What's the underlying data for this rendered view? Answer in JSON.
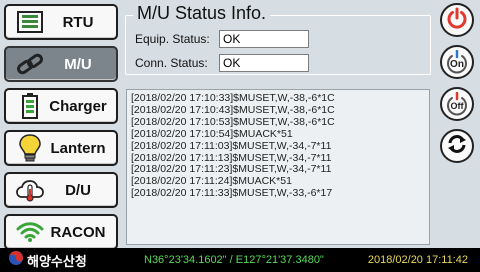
{
  "nav": [
    {
      "id": "rtu",
      "label": "RTU",
      "icon": "rtu-device-icon",
      "active": false
    },
    {
      "id": "mu",
      "label": "M/U",
      "icon": "link-icon",
      "active": true
    },
    {
      "id": "charger",
      "label": "Charger",
      "icon": "battery-icon",
      "active": false
    },
    {
      "id": "lantern",
      "label": "Lantern",
      "icon": "lightbulb-icon",
      "active": false
    },
    {
      "id": "du",
      "label": "D/U",
      "icon": "cloud-thermometer-icon",
      "active": false
    },
    {
      "id": "racon",
      "label": "RACON",
      "icon": "wifi-signal-icon",
      "active": false
    }
  ],
  "panel": {
    "title": "M/U Status Info.",
    "equip_label": "Equip. Status:",
    "equip_value": "OK",
    "conn_label": "Conn. Status:",
    "conn_value": "OK"
  },
  "log": [
    "[2018/02/20 17:10:33]$MUSET,W,-38,-6*1C",
    "[2018/02/20 17:10:43]$MUSET,W,-38,-6*1C",
    "[2018/02/20 17:10:53]$MUSET,W,-38,-6*1C",
    "[2018/02/20 17:10:54]$MUACK*51",
    "[2018/02/20 17:11:03]$MUSET,W,-34,-7*11",
    "[2018/02/20 17:11:13]$MUSET,W,-34,-7*11",
    "[2018/02/20 17:11:23]$MUSET,W,-34,-7*11",
    "[2018/02/20 17:11:24]$MUACK*51",
    "[2018/02/20 17:11:33]$MUSET,W,-33,-6*17"
  ],
  "side_buttons": [
    {
      "id": "power",
      "icon": "power-icon",
      "color": "#e03a2f"
    },
    {
      "id": "on",
      "label": "On",
      "icon": "power-on-icon"
    },
    {
      "id": "off",
      "label": "Off",
      "icon": "power-off-icon",
      "color": "#e03a2f"
    },
    {
      "id": "refresh",
      "icon": "refresh-icon"
    }
  ],
  "status_bar": {
    "agency": "해양수산청",
    "coords": "N36°23'34.1602\" / E127°21'37.3480\"",
    "datetime": "2018/02/20 17:11:42"
  }
}
